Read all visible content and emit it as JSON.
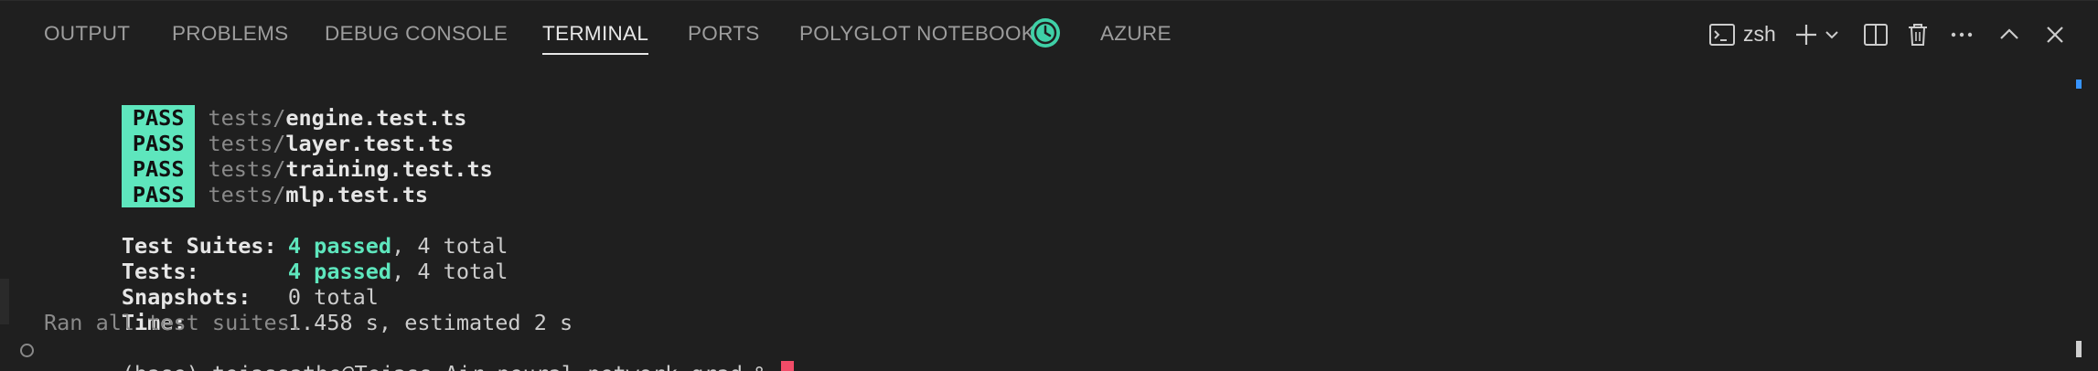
{
  "tabs": [
    {
      "label": "OUTPUT",
      "active": false
    },
    {
      "label": "PROBLEMS",
      "active": false
    },
    {
      "label": "DEBUG CONSOLE",
      "active": false
    },
    {
      "label": "TERMINAL",
      "active": true
    },
    {
      "label": "PORTS",
      "active": false
    },
    {
      "label": "POLYGLOT NOTEBOOK",
      "active": false
    },
    {
      "label": "AZURE",
      "active": false
    }
  ],
  "polyglot_icon": "clock-icon",
  "actions": {
    "shell_label": "zsh",
    "icons": [
      "terminal-icon",
      "plus-icon",
      "chevron-down-icon",
      "split-icon",
      "trash-icon",
      "ellipsis-icon",
      "chevron-up-icon",
      "close-icon"
    ]
  },
  "terminal": {
    "results": [
      {
        "badge": "PASS",
        "dir": "tests/",
        "file": "engine.test.ts"
      },
      {
        "badge": "PASS",
        "dir": "tests/",
        "file": "layer.test.ts"
      },
      {
        "badge": "PASS",
        "dir": "tests/",
        "file": "training.test.ts"
      },
      {
        "badge": "PASS",
        "dir": "tests/",
        "file": "mlp.test.ts"
      }
    ],
    "summary": {
      "suites_label": "Test Suites:",
      "suites_passed": "4 passed",
      "suites_total": ", 4 total",
      "tests_label": "Tests:",
      "tests_passed": "4 passed",
      "tests_total": ", 4 total",
      "snapshots_label": "Snapshots:",
      "snapshots_value": "0 total",
      "time_label": "Time:",
      "time_value": "1.458 s, estimated 2 s",
      "ran_all": "Ran all test suites."
    },
    "prompt": "(base) tejassathe@Tejass-Air neural-network-grad % "
  },
  "colors": {
    "background": "#1f1f1f",
    "pass_badge": "#5ee6bd",
    "passed_text": "#5ee6bd",
    "cursor": "#f14c68",
    "polyglot_icon": "#3fd0a7"
  }
}
